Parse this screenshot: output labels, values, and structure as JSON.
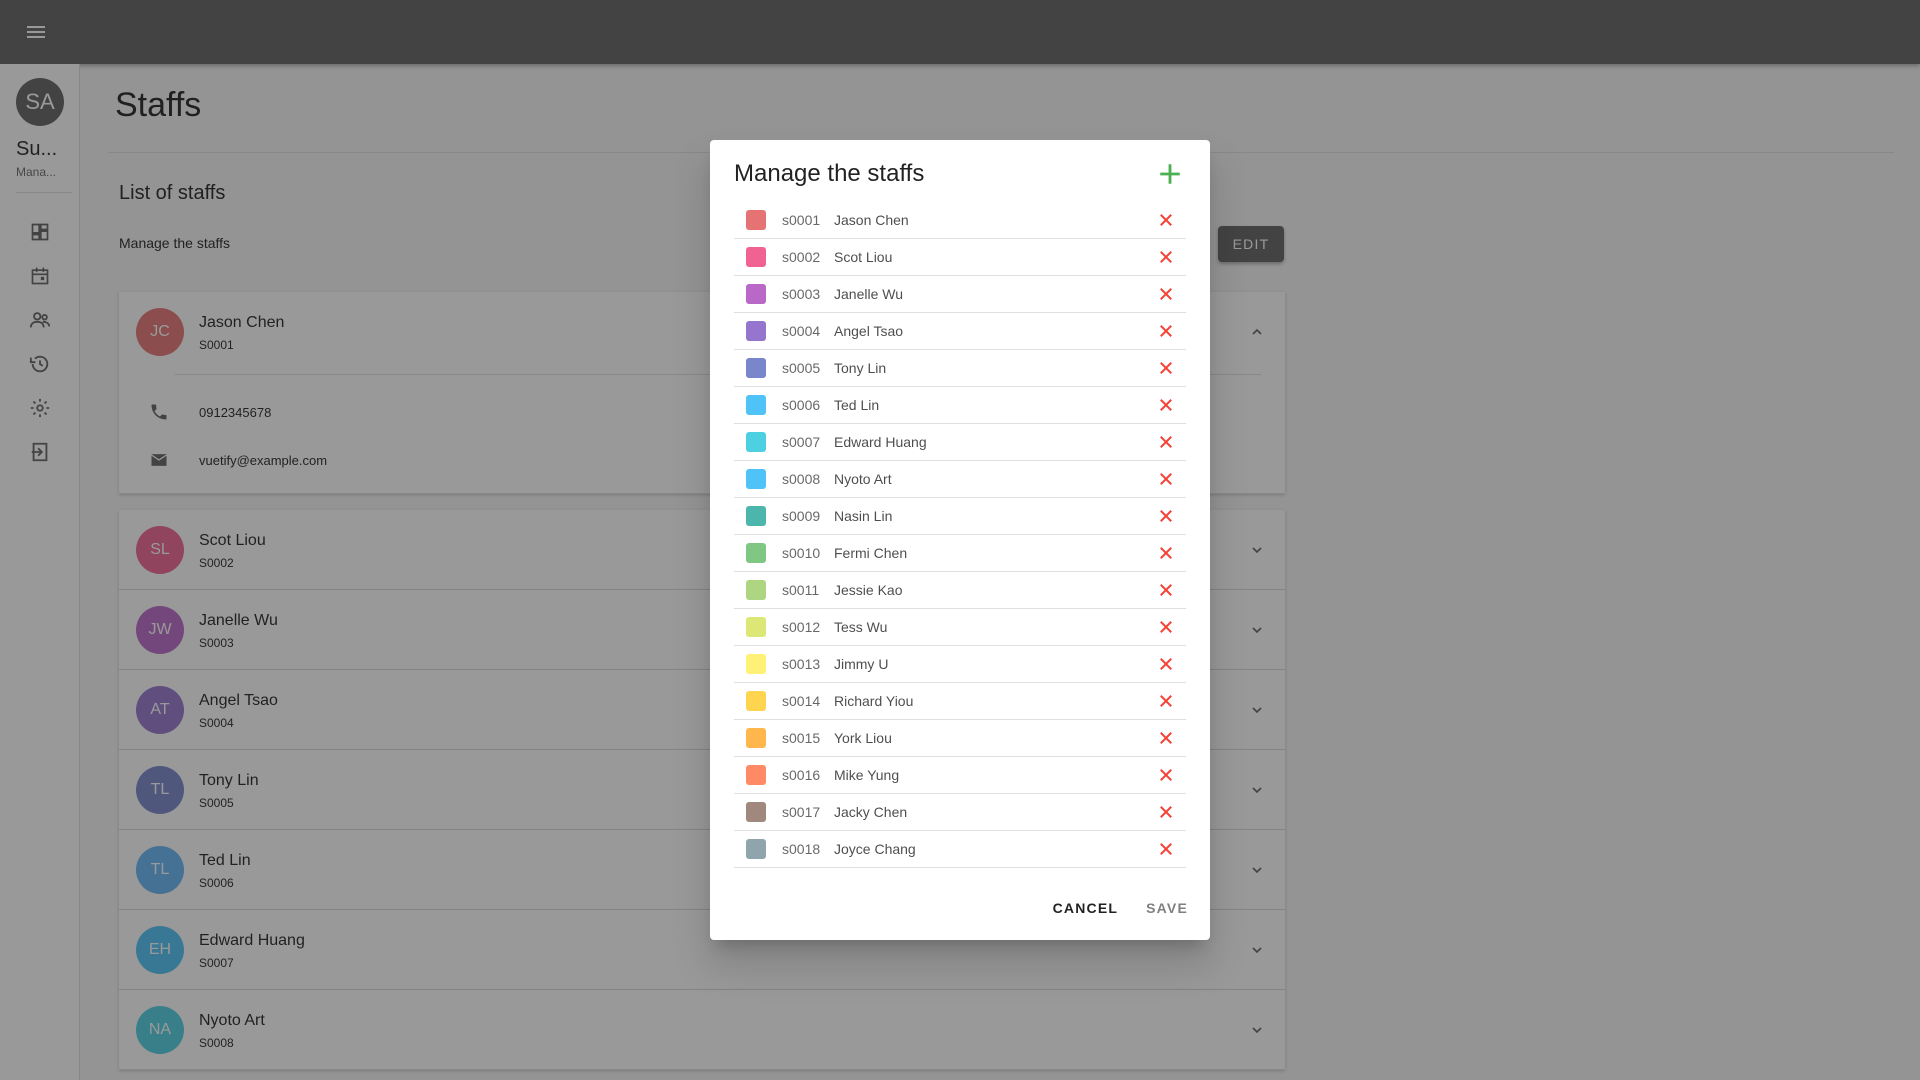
{
  "colors": {
    "appbar": "#616161",
    "accent_add": "#4caf50",
    "delete": "#f44336"
  },
  "appbar": {
    "menu_icon": "menu-icon"
  },
  "user": {
    "initials": "SA",
    "name": "Su...",
    "role": "Mana..."
  },
  "nav": [
    {
      "icon": "dashboard-icon"
    },
    {
      "icon": "calendar-icon"
    },
    {
      "icon": "people-icon"
    },
    {
      "icon": "history-icon"
    },
    {
      "icon": "settings-icon"
    },
    {
      "icon": "logout-icon"
    }
  ],
  "page": {
    "title": "Staffs",
    "section_title": "List of staffs",
    "section_subtitle": "Manage the staffs",
    "edit_label": "EDIT"
  },
  "panels": [
    {
      "initials": "JC",
      "name": "Jason Chen",
      "code": "S0001",
      "color": "#e57373",
      "open": true,
      "phone": "0912345678",
      "email": "vuetify@example.com"
    },
    {
      "initials": "SL",
      "name": "Scot Liou",
      "code": "S0002",
      "color": "#f06292"
    },
    {
      "initials": "JW",
      "name": "Janelle Wu",
      "code": "S0003",
      "color": "#ba68c8"
    },
    {
      "initials": "AT",
      "name": "Angel Tsao",
      "code": "S0004",
      "color": "#9575cd"
    },
    {
      "initials": "TL",
      "name": "Tony Lin",
      "code": "S0005",
      "color": "#7986cb"
    },
    {
      "initials": "TL",
      "name": "Ted Lin",
      "code": "S0006",
      "color": "#64b5f6"
    },
    {
      "initials": "EH",
      "name": "Edward Huang",
      "code": "S0007",
      "color": "#4fc3f7"
    },
    {
      "initials": "NA",
      "name": "Nyoto Art",
      "code": "S0008",
      "color": "#4dd0e1"
    }
  ],
  "dialog": {
    "title": "Manage the staffs",
    "add_icon": "plus-icon",
    "cancel_label": "CANCEL",
    "save_label": "SAVE",
    "staffs": [
      {
        "code": "s0001",
        "name": "Jason Chen",
        "color": "#e57373"
      },
      {
        "code": "s0002",
        "name": "Scot Liou",
        "color": "#f06292"
      },
      {
        "code": "s0003",
        "name": "Janelle Wu",
        "color": "#ba68c8"
      },
      {
        "code": "s0004",
        "name": "Angel Tsao",
        "color": "#9575cd"
      },
      {
        "code": "s0005",
        "name": "Tony Lin",
        "color": "#7986cb"
      },
      {
        "code": "s0006",
        "name": "Ted Lin",
        "color": "#4fc3f7"
      },
      {
        "code": "s0007",
        "name": "Edward Huang",
        "color": "#4dd0e1"
      },
      {
        "code": "s0008",
        "name": "Nyoto Art",
        "color": "#4fc3f7"
      },
      {
        "code": "s0009",
        "name": "Nasin Lin",
        "color": "#4db6ac"
      },
      {
        "code": "s0010",
        "name": "Fermi Chen",
        "color": "#81c784"
      },
      {
        "code": "s0011",
        "name": "Jessie Kao",
        "color": "#aed581"
      },
      {
        "code": "s0012",
        "name": "Tess Wu",
        "color": "#dce775"
      },
      {
        "code": "s0013",
        "name": "Jimmy U",
        "color": "#fff176"
      },
      {
        "code": "s0014",
        "name": "Richard Yiou",
        "color": "#ffd54f"
      },
      {
        "code": "s0015",
        "name": "York Liou",
        "color": "#ffb74d"
      },
      {
        "code": "s0016",
        "name": "Mike Yung",
        "color": "#ff8a65"
      },
      {
        "code": "s0017",
        "name": "Jacky Chen",
        "color": "#a1887f"
      },
      {
        "code": "s0018",
        "name": "Joyce Chang",
        "color": "#90a4ae"
      }
    ]
  }
}
